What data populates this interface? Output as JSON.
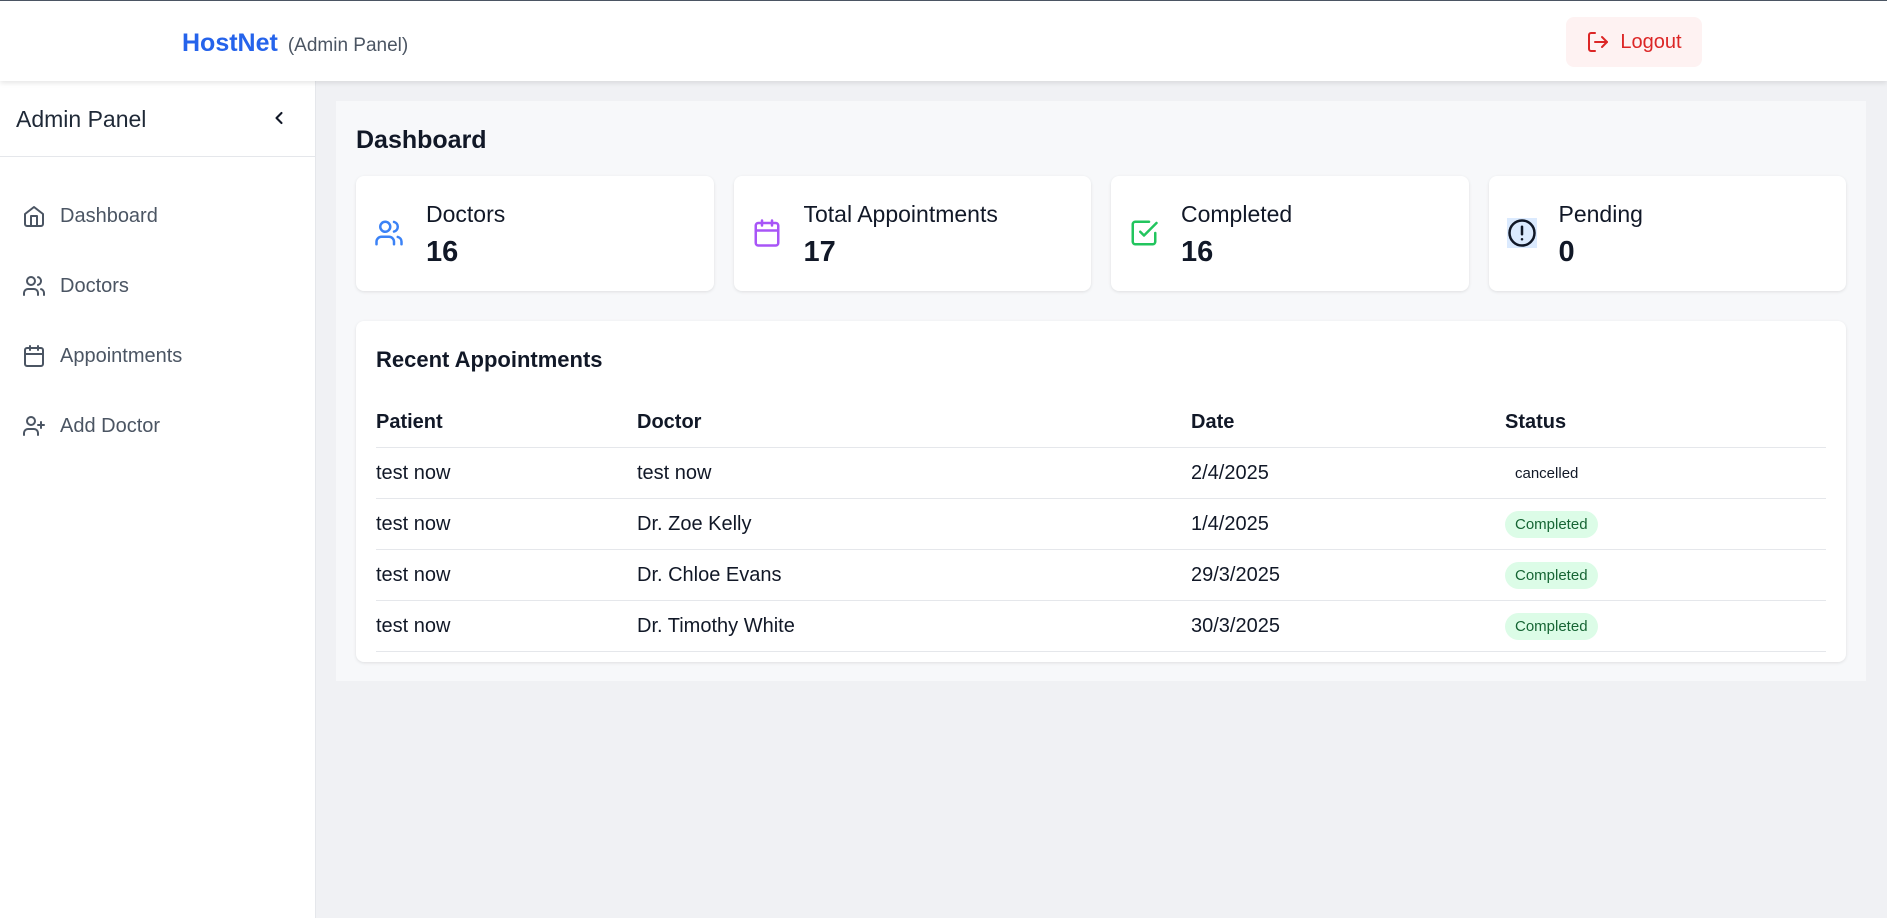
{
  "header": {
    "brand": "HostNet",
    "subtitle": "(Admin Panel)",
    "logout_label": "Logout"
  },
  "sidebar": {
    "title": "Admin Panel",
    "items": [
      {
        "label": "Dashboard",
        "icon": "home-icon"
      },
      {
        "label": "Doctors",
        "icon": "users-icon"
      },
      {
        "label": "Appointments",
        "icon": "calendar-icon"
      },
      {
        "label": "Add Doctor",
        "icon": "user-plus-icon"
      }
    ]
  },
  "main": {
    "title": "Dashboard",
    "stats": [
      {
        "label": "Doctors",
        "value": "16",
        "icon": "users-icon",
        "color": "#3b82f6"
      },
      {
        "label": "Total Appointments",
        "value": "17",
        "icon": "calendar-icon",
        "color": "#a855f7"
      },
      {
        "label": "Completed",
        "value": "16",
        "icon": "check-square-icon",
        "color": "#22c55e"
      },
      {
        "label": "Pending",
        "value": "0",
        "icon": "alert-circle-icon",
        "color": "#111827"
      }
    ],
    "recent": {
      "title": "Recent Appointments",
      "columns": [
        "Patient",
        "Doctor",
        "Date",
        "Status"
      ],
      "rows": [
        {
          "patient": "test now",
          "doctor": "test now",
          "date": "2/4/2025",
          "status": "cancelled"
        },
        {
          "patient": "test now",
          "doctor": "Dr. Zoe Kelly",
          "date": "1/4/2025",
          "status": "Completed"
        },
        {
          "patient": "test now",
          "doctor": "Dr. Chloe Evans",
          "date": "29/3/2025",
          "status": "Completed"
        },
        {
          "patient": "test now",
          "doctor": "Dr. Timothy White",
          "date": "30/3/2025",
          "status": "Completed"
        }
      ]
    }
  },
  "colors": {
    "brand": "#2563eb",
    "logout_bg": "#fef2f2",
    "logout_text": "#dc2626",
    "completed_bg": "#dcfce7",
    "completed_text": "#166534"
  }
}
